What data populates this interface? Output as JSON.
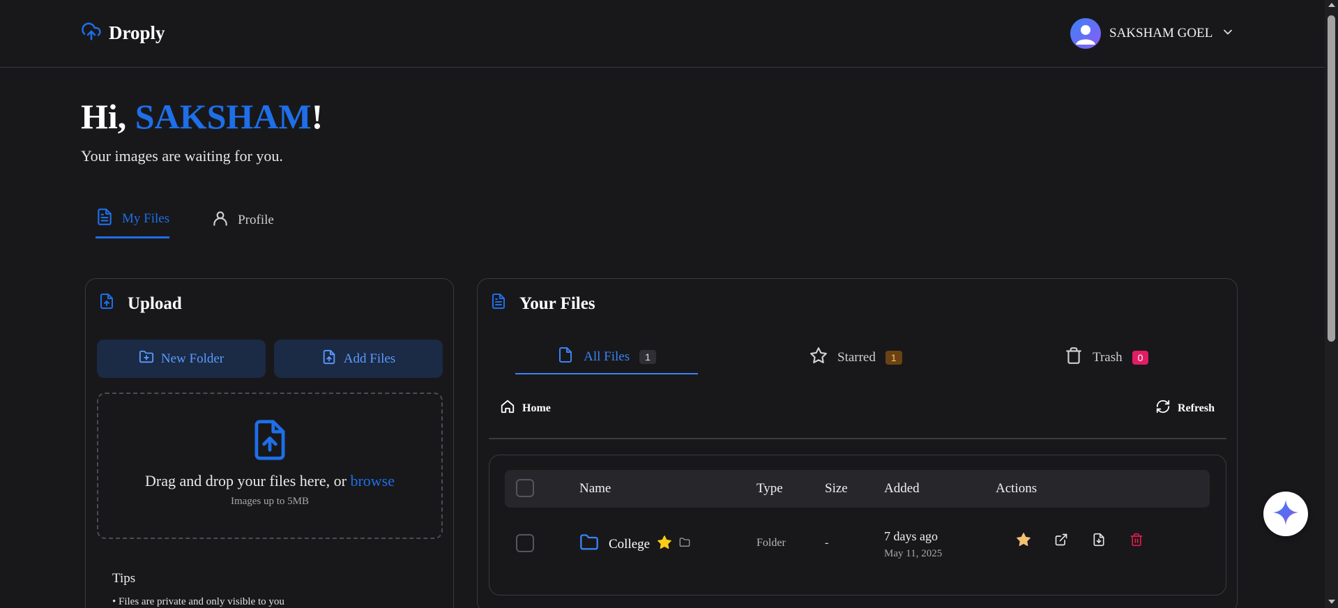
{
  "header": {
    "brand": "Droply",
    "user_name": "SAKSHAM GOEL"
  },
  "greeting": {
    "prefix": "Hi, ",
    "name": "SAKSHAM",
    "suffix": "!",
    "subtitle": "Your images are waiting for you."
  },
  "main_tabs": [
    {
      "label": "My Files",
      "active": true
    },
    {
      "label": "Profile",
      "active": false
    }
  ],
  "upload": {
    "title": "Upload",
    "new_folder_label": "New Folder",
    "add_files_label": "Add Files",
    "dropzone_text": "Drag and drop your files here, or ",
    "browse_label": "browse",
    "dropzone_subtext": "Images up to 5MB",
    "tips_title": "Tips",
    "tips": [
      "• Files are private and only visible to you"
    ]
  },
  "files": {
    "title": "Your Files",
    "tabs": [
      {
        "label": "All Files",
        "count": "1",
        "active": true
      },
      {
        "label": "Starred",
        "count": "1",
        "active": false
      },
      {
        "label": "Trash",
        "count": "0",
        "active": false
      }
    ],
    "breadcrumb_home": "Home",
    "refresh_label": "Refresh",
    "columns": [
      "Name",
      "Type",
      "Size",
      "Added",
      "Actions"
    ],
    "rows": [
      {
        "name": "College",
        "starred": true,
        "type": "Folder",
        "size": "-",
        "added_relative": "7 days ago",
        "added_date": "May 11, 2025",
        "actions": [
          "star-icon",
          "external-link-icon",
          "download-icon",
          "trash-icon"
        ]
      }
    ]
  },
  "colors": {
    "accent": "#1e6fe8",
    "background": "#18181b",
    "starred_badge": "#6b4312",
    "trash_badge": "#e11d63",
    "star": "#facc15",
    "delete": "#e11d48"
  }
}
